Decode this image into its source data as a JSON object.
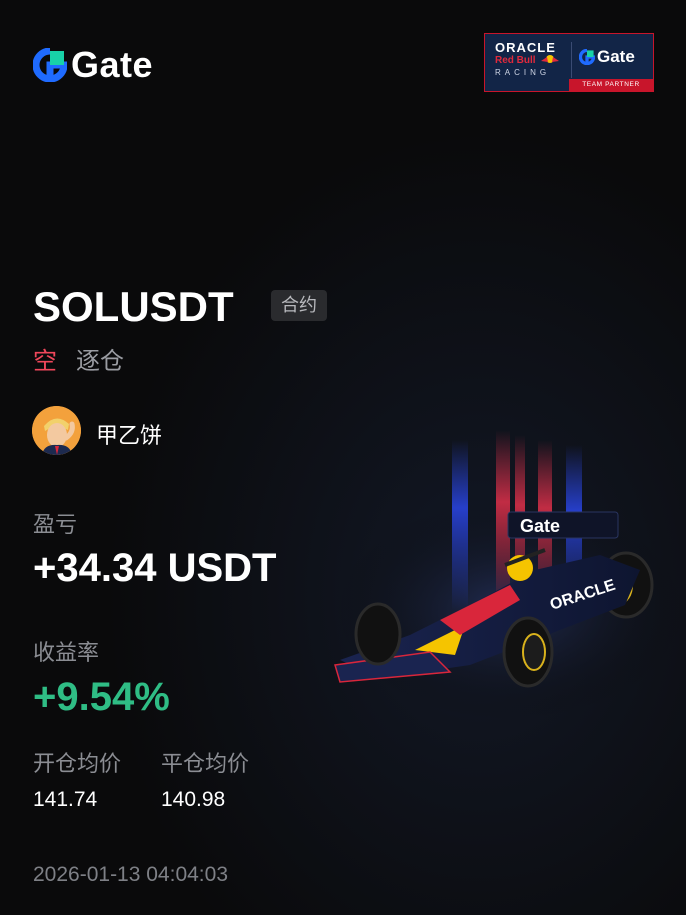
{
  "brand": {
    "logo_text": "Gate",
    "partner_badge": {
      "oracle": "ORACLE",
      "red_bull": "Red Bull",
      "racing": "RACING",
      "gate": "Gate",
      "team_partner": "TEAM PARTNER"
    }
  },
  "position": {
    "symbol": "SOLUSDT",
    "contract_tag": "合约",
    "side": "空",
    "margin_mode": "逐仓"
  },
  "user": {
    "name": "甲乙饼"
  },
  "stats": {
    "pnl_label": "盈亏",
    "pnl_value": "+34.34 USDT",
    "roi_label": "收益率",
    "roi_value": "+9.54%",
    "entry_label": "开仓均价",
    "entry_value": "141.74",
    "exit_label": "平仓均价",
    "exit_value": "140.98"
  },
  "timestamp": "2026-01-13 04:04:03",
  "car_wing_text": "Gate",
  "car_sidepod_text": "ORACLE",
  "colors": {
    "background": "#0a0a0b",
    "short_red": "#f0475b",
    "profit_green": "#2fbd85",
    "brand_blue": "#1f6bff",
    "partner_red": "#c8152b",
    "partner_navy": "#122547"
  },
  "icons": {
    "brand_mark": "gate-logo-icon",
    "avatar": "user-avatar-icon",
    "car": "f1-car-illustration"
  }
}
